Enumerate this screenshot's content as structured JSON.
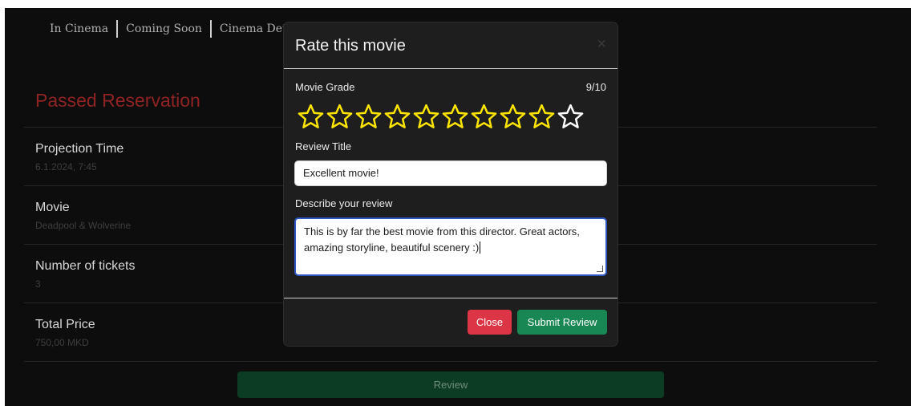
{
  "nav": {
    "items": [
      "In Cinema",
      "Coming Soon",
      "Cinema Deta"
    ]
  },
  "page": {
    "heading": "Passed Reservation",
    "rows": [
      {
        "label": "Projection Time",
        "value": "6.1.2024, 7:45"
      },
      {
        "label": "Movie",
        "value": "Deadpool & Wolverine"
      },
      {
        "label": "Number of tickets",
        "value": "3"
      },
      {
        "label": "Total Price",
        "value": "750,00 MKD"
      }
    ],
    "review_button": "Review"
  },
  "modal": {
    "title": "Rate this movie",
    "close_glyph": "×",
    "grade_label": "Movie Grade",
    "grade_value": "9/10",
    "rating": 9,
    "max_rating": 10,
    "star_color_filled": "#ffe600",
    "star_color_empty": "#ffffff",
    "review_title_label": "Review Title",
    "review_title_value": "Excellent movie!",
    "review_desc_label": "Describe your review",
    "review_desc_value": "This is by far the best movie from this director. Great actors, amazing storyline, beautiful scenery :)",
    "close_button": "Close",
    "submit_button": "Submit Review"
  },
  "colors": {
    "accent_red": "#dc3545",
    "accent_green": "#198754",
    "heading_red": "#8e2323"
  }
}
